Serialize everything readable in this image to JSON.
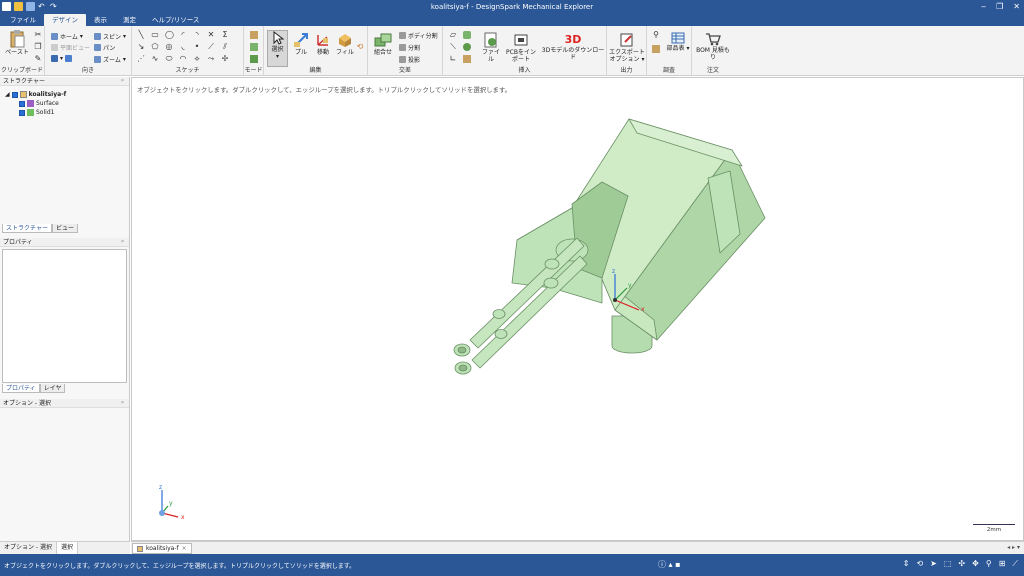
{
  "window": {
    "title": "koalitsiya-f - DesignSpark Mechanical Explorer",
    "controls": [
      "‒",
      "❐",
      "✕"
    ]
  },
  "menu": {
    "tabs": [
      "ファイル",
      "デザイン",
      "表示",
      "測定",
      "ヘルプ/リソース"
    ],
    "active": "デザイン"
  },
  "ribbon": {
    "clipboard": {
      "label": "クリップボード",
      "paste": "ペースト"
    },
    "orient": {
      "label": "向き",
      "home": "ホーム",
      "plane_view": "平面ビュー",
      "spin": "スピン",
      "pan": "パン",
      "zoom": "ズーム"
    },
    "sketch": {
      "label": "スケッチ"
    },
    "mode": {
      "label": "モード"
    },
    "edit": {
      "label": "編集",
      "select": "選択",
      "pull": "プル",
      "move": "移動",
      "fill": "フィル"
    },
    "intersect": {
      "label": "交差",
      "combine": "組合せ",
      "split_body": "ボディ分割",
      "split": "分割",
      "project": "投影"
    },
    "insert": {
      "label": "挿入",
      "file": "ファイル",
      "pcb": "PCBをインポート",
      "model_download": "3Dモデルのダウンロード",
      "badge_3d": "3D"
    },
    "output": {
      "label": "出力",
      "export": "エクスポートオプション"
    },
    "investigate": {
      "label": "調査",
      "parts_table": "部品表"
    },
    "order": {
      "label": "注文",
      "bom": "BOM 見積もり"
    }
  },
  "structure": {
    "title": "ストラクチャー",
    "root": "koalitsiya-f",
    "children": [
      "Surface",
      "Solid1"
    ],
    "tabs": [
      "ストラクチャー",
      "ビュー"
    ]
  },
  "properties": {
    "title": "プロパティ",
    "tabs": [
      "プロパティ",
      "レイヤ"
    ]
  },
  "options": {
    "title": "オプション - 選択",
    "bottom_tabs": [
      "オプション - 選択",
      "選択"
    ]
  },
  "viewport": {
    "hint": "オブジェクトをクリックします。ダブルクリックして、エッジループを選択します。トリプルクリックしてソリッドを選択します。",
    "scale_label": "2mm",
    "axis_labels": {
      "x": "x",
      "y": "y",
      "z": "z"
    },
    "model_color": "#bfe3b8"
  },
  "document_tab": {
    "name": "koalitsiya-f"
  },
  "status": {
    "message": "オブジェクトをクリックします。ダブルクリックして、エッジループを選択します。トリプルクリックしてソリッドを選択します。"
  },
  "colors": {
    "accent": "#2b5797",
    "ribbon_bg": "#f3f3f3"
  }
}
